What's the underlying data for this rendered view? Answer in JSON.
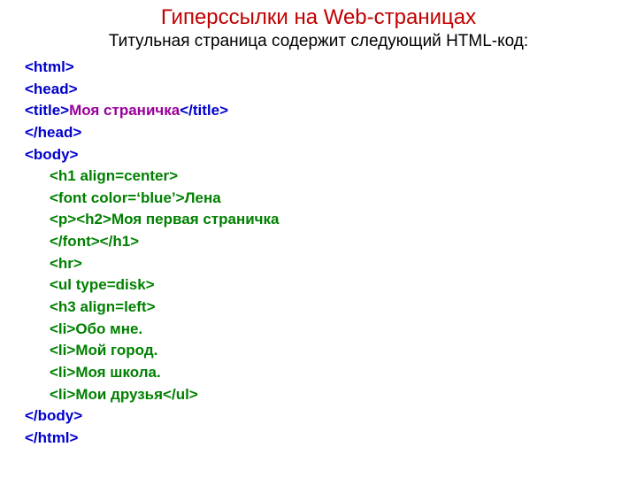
{
  "title": "Гиперссылки на Web-страницах",
  "subtitle": "Титульная страница  содержит следующий HTML-код:",
  "code": {
    "l1": "<html>",
    "l2": "<head>",
    "l3a": "<title>",
    "l3b": "Моя страничка",
    "l3c": "</title>",
    "l4": "</head>",
    "l5": "<body>",
    "l6": "<h1 align=center>",
    "l7a": "<font color=‘blue’>",
    "l7b": "Лена",
    "l8a": "<p><h2>",
    "l8b": "Моя первая страничка",
    "l9": "</font></h1>",
    "l10": "<hr>",
    "l11": "<ul type=disk>",
    "l12": "<h3 align=left>",
    "l13a": "<li>",
    "l13b": "Обо мне.",
    "l14a": "<li>",
    "l14b": "Мой город.",
    "l15a": "<li>",
    "l15b": "Моя школа.",
    "l16a": "<li>",
    "l16b": "Мои друзья",
    "l16c": "</ul>",
    "l17": "</body>",
    "l18": "</html>"
  }
}
